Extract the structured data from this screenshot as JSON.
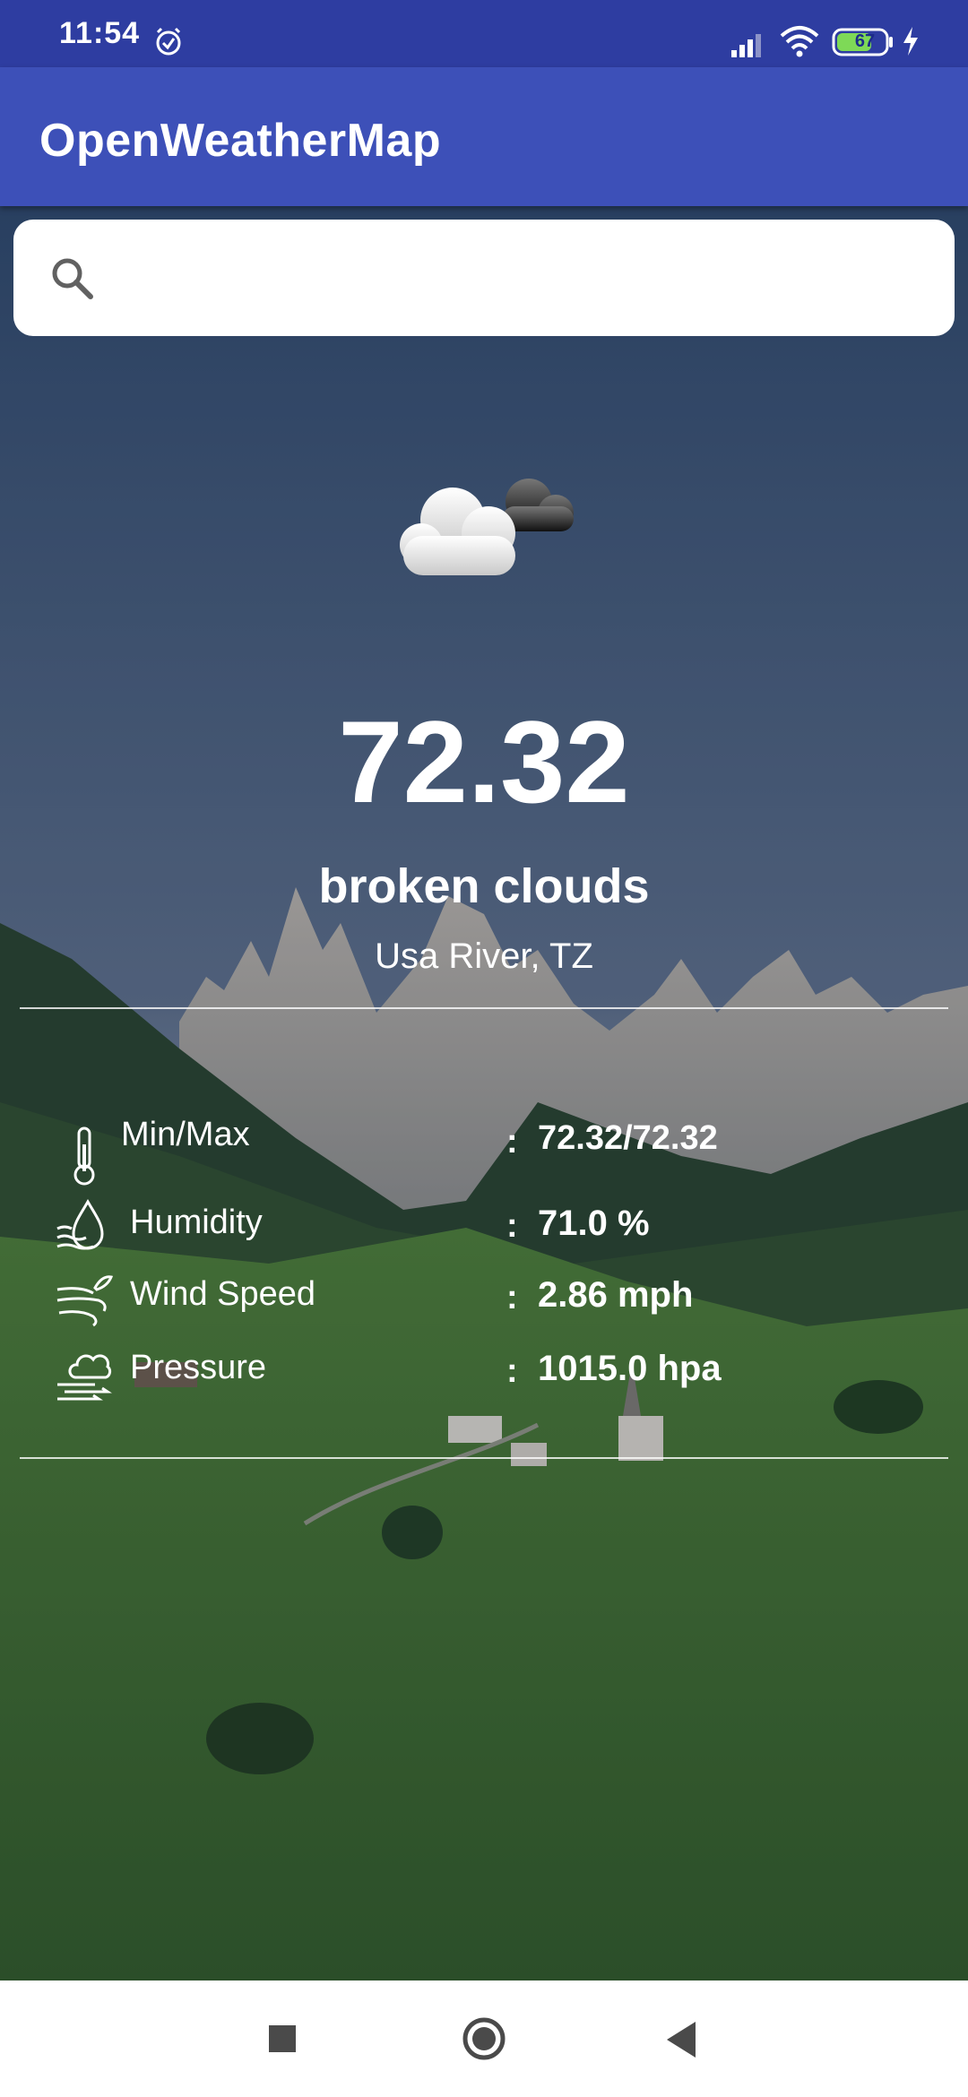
{
  "status_bar": {
    "time": "11:54",
    "battery": "67",
    "icons": [
      "alarm-icon",
      "signal-icon",
      "wifi-icon",
      "battery-icon",
      "charge-icon"
    ]
  },
  "app_bar": {
    "title": "OpenWeatherMap"
  },
  "search": {
    "value": "",
    "placeholder": "",
    "icon": "search-icon"
  },
  "weather": {
    "icon": "broken-clouds-icon",
    "temperature": "72.32",
    "description": "broken clouds",
    "location": "Usa River, TZ"
  },
  "details": [
    {
      "icon": "thermometer-icon",
      "label": "Min/Max",
      "separator": ":",
      "value": "72.32/72.32"
    },
    {
      "icon": "humidity-icon",
      "label": "Humidity",
      "separator": ":",
      "value": "71.0 %"
    },
    {
      "icon": "wind-icon",
      "label": "Wind Speed",
      "separator": ":",
      "value": "2.86 mph"
    },
    {
      "icon": "pressure-icon",
      "label": "Pressure",
      "separator": ":",
      "value": "1015.0 hpa"
    }
  ],
  "nav_bar": {
    "buttons": [
      "recents-button",
      "home-button",
      "back-button"
    ]
  },
  "colors": {
    "status_bar": "#2e3da1",
    "app_bar": "#3d50b8",
    "sky_top": "#2c4467",
    "sky_bottom": "#6d7a93",
    "meadow": "#3d6a2c"
  }
}
